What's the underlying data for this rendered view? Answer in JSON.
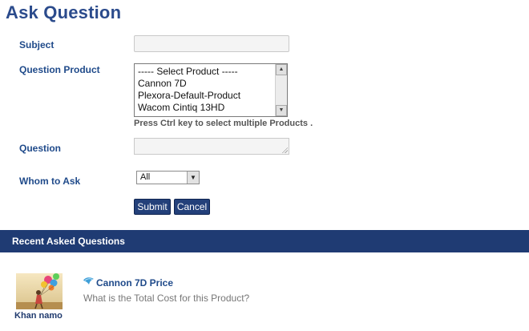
{
  "page": {
    "title": "Ask Question"
  },
  "form": {
    "subject_label": "Subject",
    "subject_value": "",
    "product_label": "Question Product",
    "product_options": [
      "----- Select Product -----",
      "Cannon 7D",
      "Plexora-Default-Product",
      "Wacom Cintiq 13HD"
    ],
    "product_hint": "Press Ctrl key to select multiple Products .",
    "question_label": "Question",
    "question_value": "",
    "whom_label": "Whom to Ask",
    "whom_value": "All",
    "submit_label": "Submit",
    "cancel_label": "Cancel"
  },
  "recent": {
    "title": "Recent Asked Questions",
    "items": [
      {
        "author": "Khan namo",
        "question_title": "Cannon 7D Price",
        "question_body": "What is the Total Cost for this Product?"
      }
    ]
  },
  "colors": {
    "brand": "#1f3b73",
    "button": "#23407a",
    "label": "#1f4a8a"
  }
}
